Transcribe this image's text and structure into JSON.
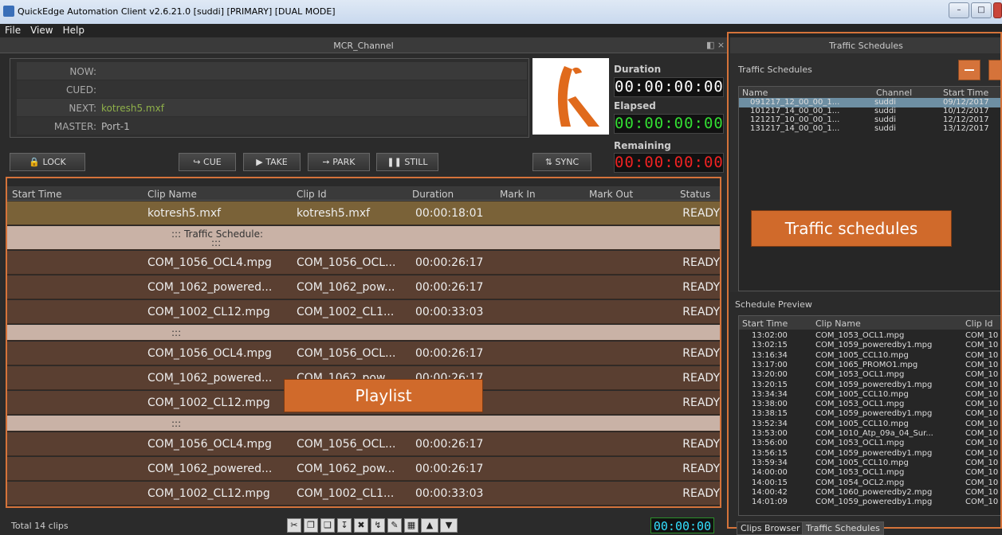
{
  "window": {
    "title": "QuickEdge Automation Client v2.6.21.0 [suddi] [PRIMARY] [DUAL MODE]"
  },
  "menu": [
    "File",
    "View",
    "Help"
  ],
  "mcr": {
    "panel_title": "MCR_Channel",
    "status": [
      {
        "label": "NOW:",
        "value": ""
      },
      {
        "label": "CUED:",
        "value": ""
      },
      {
        "label": "NEXT:",
        "value": "kotresh5.mxf"
      },
      {
        "label": "MASTER:",
        "value": "Port-1"
      }
    ],
    "timers": [
      {
        "label": "Duration",
        "value": "00:00:00:00",
        "color": "#ffffff"
      },
      {
        "label": "Elapsed",
        "value": "00:00:00:00",
        "color": "#33dd33"
      },
      {
        "label": "Remaining",
        "value": "00:00:00:00",
        "color": "#ee2222"
      }
    ],
    "buttons": {
      "lock": "LOCK",
      "cue": "CUE",
      "take": "TAKE",
      "park": "PARK",
      "still": "STILL",
      "sync": "SYNC"
    }
  },
  "playlist": {
    "columns": [
      "Start Time",
      "Clip Name",
      "Clip Id",
      "Duration",
      "Mark In",
      "Mark Out",
      "Status"
    ],
    "rows": [
      {
        "type": "clip",
        "selected": true,
        "name": "kotresh5.mxf",
        "id": "kotresh5.mxf",
        "duration": "00:00:18:01",
        "status": "READY"
      },
      {
        "type": "sep",
        "text": "::: Traffic Schedule:",
        "text2": ":::"
      },
      {
        "type": "clip",
        "name": "COM_1056_OCL4.mpg",
        "id": "COM_1056_OCL...",
        "duration": "00:00:26:17",
        "status": "READY"
      },
      {
        "type": "clip",
        "name": "COM_1062_powered...",
        "id": "COM_1062_pow...",
        "duration": "00:00:26:17",
        "status": "READY"
      },
      {
        "type": "clip",
        "name": "COM_1002_CL12.mpg",
        "id": "COM_1002_CL1...",
        "duration": "00:00:33:03",
        "status": "READY"
      },
      {
        "type": "sep",
        "text": ":::",
        "text2": ""
      },
      {
        "type": "clip",
        "name": "COM_1056_OCL4.mpg",
        "id": "COM_1056_OCL...",
        "duration": "00:00:26:17",
        "status": "READY"
      },
      {
        "type": "clip",
        "name": "COM_1062_powered...",
        "id": "COM_1062_pow...",
        "duration": "00:00:26:17",
        "status": "READY"
      },
      {
        "type": "clip",
        "name": "COM_1002_CL12.mpg",
        "id": "COM_1002_CL1...",
        "duration": "00:00:33:03",
        "status": "READY"
      },
      {
        "type": "sep",
        "text": ":::",
        "text2": ""
      },
      {
        "type": "clip",
        "name": "COM_1056_OCL4.mpg",
        "id": "COM_1056_OCL...",
        "duration": "00:00:26:17",
        "status": "READY"
      },
      {
        "type": "clip",
        "name": "COM_1062_powered...",
        "id": "COM_1062_pow...",
        "duration": "00:00:26:17",
        "status": "READY"
      },
      {
        "type": "clip",
        "name": "COM_1002_CL12.mpg",
        "id": "COM_1002_CL1...",
        "duration": "00:00:33:03",
        "status": "READY"
      },
      {
        "type": "sep",
        "text": ":::",
        "text2": ""
      }
    ],
    "annotation": "Playlist",
    "total": "Total 14 clips",
    "timecode": "00:00:00"
  },
  "traffic": {
    "panel_title": "Traffic Schedules",
    "section_label": "Traffic Schedules",
    "columns": [
      "Name",
      "Channel",
      "Start Time"
    ],
    "rows": [
      {
        "name": "091217_12_00_00_1...",
        "channel": "suddi",
        "start": "09/12/2017"
      },
      {
        "name": "101217_14_00_00_1...",
        "channel": "suddi",
        "start": "10/12/2017"
      },
      {
        "name": "121217_10_00_00_1...",
        "channel": "suddi",
        "start": "12/12/2017"
      },
      {
        "name": "131217_14_00_00_1...",
        "channel": "suddi",
        "start": "13/12/2017"
      }
    ],
    "annotation": "Traffic schedules"
  },
  "preview": {
    "title": "Schedule Preview",
    "columns": [
      "Start Time",
      "Clip Name",
      "Clip Id"
    ],
    "rows": [
      [
        "13:02:00",
        "COM_1053_OCL1.mpg",
        "COM_10"
      ],
      [
        "13:02:15",
        "COM_1059_poweredby1.mpg",
        "COM_10"
      ],
      [
        "13:16:34",
        "COM_1005_CCL10.mpg",
        "COM_10"
      ],
      [
        "13:17:00",
        "COM_1065_PROMO1.mpg",
        "COM_10"
      ],
      [
        "13:20:00",
        "COM_1053_OCL1.mpg",
        "COM_10"
      ],
      [
        "13:20:15",
        "COM_1059_poweredby1.mpg",
        "COM_10"
      ],
      [
        "13:34:34",
        "COM_1005_CCL10.mpg",
        "COM_10"
      ],
      [
        "13:38:00",
        "COM_1053_OCL1.mpg",
        "COM_10"
      ],
      [
        "13:38:15",
        "COM_1059_poweredby1.mpg",
        "COM_10"
      ],
      [
        "13:52:34",
        "COM_1005_CCL10.mpg",
        "COM_10"
      ],
      [
        "13:53:00",
        "COM_1010_Atp_09a_04_Sur...",
        "COM_10"
      ],
      [
        "13:56:00",
        "COM_1053_OCL1.mpg",
        "COM_10"
      ],
      [
        "13:56:15",
        "COM_1059_poweredby1.mpg",
        "COM_10"
      ],
      [
        "13:59:34",
        "COM_1005_CCL10.mpg",
        "COM_10"
      ],
      [
        "14:00:00",
        "COM_1053_OCL1.mpg",
        "COM_10"
      ],
      [
        "14:00:15",
        "COM_1054_OCL2.mpg",
        "COM_10"
      ],
      [
        "14:00:42",
        "COM_1060_poweredby2.mpg",
        "COM_10"
      ],
      [
        "14:01:09",
        "COM_1059_poweredby1.mpg",
        "COM_10"
      ]
    ]
  },
  "tabs": [
    "Clips Browser",
    "Traffic Schedules"
  ],
  "colors": {
    "accent": "#d5733a",
    "row": "#5a3f31",
    "selected_row": "#7a6238"
  }
}
